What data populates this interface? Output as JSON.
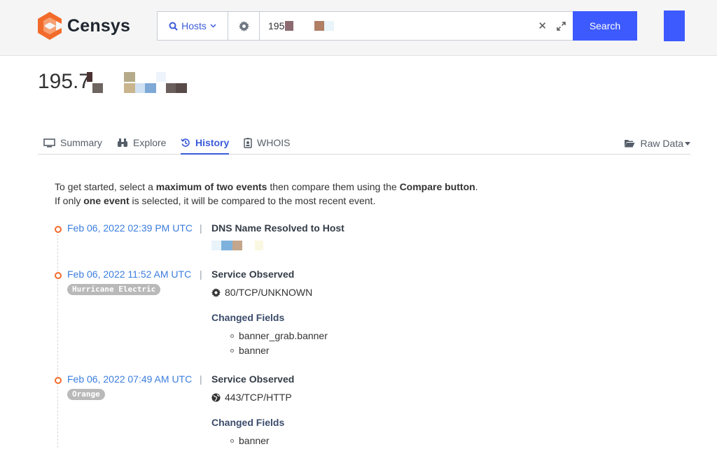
{
  "header": {
    "brand": "Censys",
    "search_type": "Hosts",
    "query_value": "195",
    "search_label": "Search"
  },
  "host": {
    "title_prefix": "195.7"
  },
  "tabs": [
    {
      "label": "Summary",
      "icon": "monitor-icon"
    },
    {
      "label": "Explore",
      "icon": "binoculars-icon"
    },
    {
      "label": "History",
      "icon": "history-icon"
    },
    {
      "label": "WHOIS",
      "icon": "id-badge-icon"
    }
  ],
  "raw_data": {
    "label": "Raw Data",
    "icon": "folder-open-icon"
  },
  "intro": {
    "line1_pre": "To get started, select a ",
    "line1_b1": "maximum of two events",
    "line1_mid": " then compare them using the ",
    "line1_b2": "Compare button",
    "line1_end": ".",
    "line2_pre": "If only ",
    "line2_b": "one event",
    "line2_end": " is selected, it will be compared to the most recent event."
  },
  "events": [
    {
      "date": "Feb 06, 2022 02:39 PM UTC",
      "title": "DNS Name Resolved to Host"
    },
    {
      "date": "Feb 06, 2022 11:52 AM UTC",
      "badge": "Hurricane Electric",
      "title": "Service Observed",
      "service": "80/TCP/UNKNOWN",
      "service_icon": "gear-icon",
      "changed_label": "Changed Fields",
      "fields": [
        "banner_grab.banner",
        "banner"
      ]
    },
    {
      "date": "Feb 06, 2022 07:49 AM UTC",
      "badge": "Orange",
      "title": "Service Observed",
      "service": "443/TCP/HTTP",
      "service_icon": "globe-icon",
      "changed_label": "Changed Fields",
      "fields": [
        "banner"
      ]
    }
  ],
  "colors": {
    "accent": "#3a5bd9",
    "search_button": "#3d5afe",
    "timeline_dot": "#f26b2a",
    "link": "#3b7ddd"
  }
}
